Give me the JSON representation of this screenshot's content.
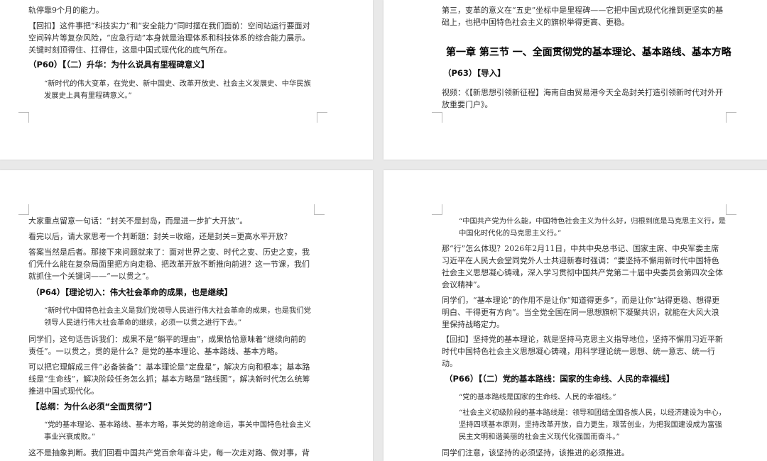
{
  "page1": {
    "line_top": "轨停靠9个月的能力。",
    "huikou": "【回扣】这件事把“科技实力”和“安全能力”同时摆在我们面前：空间站运行要面对空间碎片等复杂风险，“应急行动”本身就是治理体系和科技体系的综合能力展示。关键时刻顶得住、扛得住，这是中国式现代化的底气所在。",
    "heading": "（P60）【（二）升华：为什么说具有里程碑意义】",
    "quote": "“新时代的伟大变革，在党史、新中国史、改革开放史、社会主义发展史、中华民族发展史上具有里程碑意义。”"
  },
  "page2": {
    "para_top": "第三，变革的意义在“五史”坐标中是里程碑——它把中国式现代化推到更坚实的基础上，也把中国特色社会主义的旗帜举得更高、更稳。",
    "chapter_title": "第一章 第三节  一、全面贯彻党的基本理论、基本路线、基本方略",
    "heading": "（P63）【导入】",
    "video": "视频：《【新思想引领新征程】海南自由贸易港今天全岛封关打造引领新时代对外开放重要门户》。"
  },
  "page3": {
    "p1": "大家重点留意一句话：“封关不是封岛，而是进一步扩大开放”。",
    "p2": "看完以后，请大家思考一个判断题：封关=收缩，还是封关=更高水平开放？",
    "p3": "答案当然是后者。那接下来问题就来了：面对世界之变、时代之变、历史之变，我们凭什么能在复杂局面里把方向走稳、把改革开放不断推向前进？这一节课，我们就抓住一个关键词——“一以贯之”。",
    "heading1": "（P64）【理论切入：伟大社会革命的成果，也是继续】",
    "quote1": "“新时代中国特色社会主义是我们党领导人民进行伟大社会革命的成果，也是我们党领导人民进行伟大社会革命的继续，必须一以贯之进行下去。”",
    "p4": "同学们，这句话告诉我们：成果不是“躺平的理由”，成果恰恰意味着“继续向前的责任”。一以贯之，贯的是什么？是党的基本理论、基本路线、基本方略。",
    "p5": "可以把它理解成三件“必备装备”：基本理论是“定盘星”，解决方向和根本；基本路线是“生命线”，解决阶段任务怎么抓；基本方略是“路线图”，解决新时代怎么统筹推进中国式现代化。",
    "heading2": "【总纲：为什么必须“全面贯彻”】",
    "quote2": "“党的基本理论、基本路线、基本方略，事关党的前途命运，事关中国特色社会主义事业兴衰成败。”",
    "p6": "这不是抽象判断。我们回看中国共产党百余年奋斗史，每一次走对路、做对事，背"
  },
  "page4": {
    "quote1": "“中国共产党为什么能，中国特色社会主义为什么好，归根到底是马克思主义行，是中国化时代化的马克思主义行。”",
    "p1": "那“行”怎么体现？2026年2月11日，中共中央总书记、国家主席、中央军委主席习近平在人民大会堂同党外人士共迎新春时强调：“要坚持不懈用新时代中国特色社会主义思想凝心铸魂，深入学习贯彻中国共产党第二十届中央委员会第四次全体会议精神”。",
    "p2": "同学们，“基本理论”的作用不是让你“知道得更多”，而是让你“站得更稳、想得更明白、干得更有方向”。当全党全国在同一思想旗帜下凝聚共识，就能在大风大浪里保持战略定力。",
    "huikou": "【回扣】坚持党的基本理论，就是坚持马克思主义指导地位，坚持不懈用习近平新时代中国特色社会主义思想凝心铸魂，用科学理论统一思想、统一意志、统一行动。",
    "heading": "（P66）【（二）党的基本路线：国家的生命线、人民的幸福线】",
    "quote2": "“党的基本路线是国家的生命线、人民的幸福线。”",
    "quote3": "“社会主义初级阶段的基本路线是：领导和团结全国各族人民，以经济建设为中心，坚持四项基本原则，坚持改革开放，自力更生，艰苦创业，为把我国建设成为富强民主文明和谐美丽的社会主义现代化强国而奋斗。”",
    "p3": "同学们注意，该坚持的必须坚持，该推进的必须推进。"
  }
}
